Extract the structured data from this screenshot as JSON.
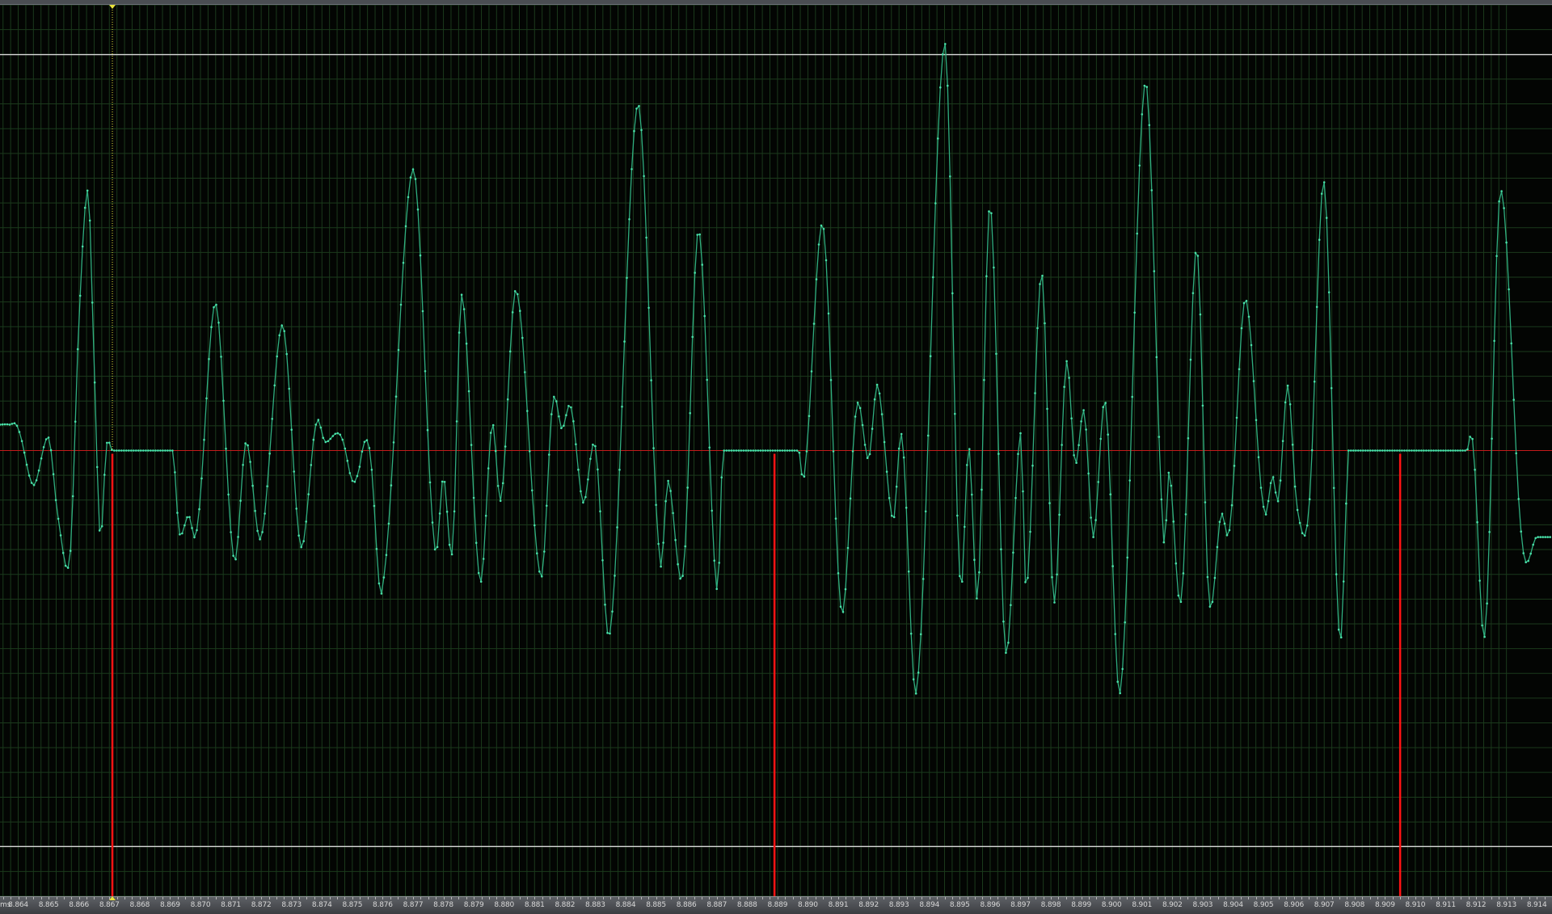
{
  "colors": {
    "background": "#030503",
    "grid": "#1b3a1c",
    "waveform": "#2fae7f",
    "sample_dot": "#49e0a8",
    "zero_line": "#c41a1a",
    "marker": "#ff1414",
    "limit_line": "#d8d8d8",
    "playhead": "#e8e23a",
    "ruler_text": "#d8d8d8"
  },
  "ruler": {
    "unit_label": "ms",
    "tick_labels": [
      "8.864",
      "8.865",
      "8.866",
      "8.867",
      "8.868",
      "8.869",
      "8.870",
      "8.871",
      "8.872",
      "8.873",
      "8.874",
      "8.875",
      "8.876",
      "8.877",
      "8.878",
      "8.879",
      "8.880",
      "8.881",
      "8.882",
      "8.883",
      "8.884",
      "8.885",
      "8.886",
      "8.887",
      "8.888",
      "8.889",
      "8.890",
      "8.891",
      "8.892",
      "8.893",
      "8.894",
      "8.895",
      "8.896",
      "8.897",
      "8.898",
      "8.899",
      "8.900",
      "8.901",
      "8.902",
      "8.903",
      "8.904",
      "8.905",
      "8.906",
      "8.907",
      "8.908",
      "8.909",
      "8.910",
      "8.911",
      "8.912",
      "8.913",
      "8.914"
    ]
  },
  "chart_data": {
    "type": "line",
    "x_unit": "ms",
    "x_range": [
      8.8634,
      8.9145
    ],
    "y_range": [
      -1.03,
      1.03
    ],
    "limit_levels": [
      0.915,
      -0.915
    ],
    "playhead_ms": 8.8671,
    "transient_markers_ms": [
      8.8671,
      8.8889,
      8.9095
    ],
    "silent_segments_ms": [
      [
        8.8671,
        8.8691
      ],
      [
        8.8889,
        8.8897
      ],
      [
        8.9095,
        8.9117
      ]
    ],
    "waveform": {
      "name": "",
      "keypoints": [
        [
          8.8634,
          0.06
        ],
        [
          8.8637,
          0.06
        ],
        [
          8.864,
          0.05
        ],
        [
          8.8645,
          -0.08
        ],
        [
          8.865,
          0.03
        ],
        [
          8.8653,
          -0.15
        ],
        [
          8.8657,
          -0.25
        ],
        [
          8.866,
          0.3
        ],
        [
          8.8663,
          0.6
        ],
        [
          8.8665,
          0.2
        ],
        [
          8.8667,
          -0.2
        ],
        [
          8.8669,
          0.01
        ],
        [
          8.8671,
          0.0
        ],
        [
          8.8691,
          0.0
        ],
        [
          8.8693,
          -0.19
        ],
        [
          8.8696,
          -0.15
        ],
        [
          8.8699,
          -0.17
        ],
        [
          8.8705,
          0.34
        ],
        [
          8.8711,
          -0.25
        ],
        [
          8.8715,
          0.02
        ],
        [
          8.872,
          -0.2
        ],
        [
          8.8727,
          0.29
        ],
        [
          8.8733,
          -0.22
        ],
        [
          8.8738,
          0.06
        ],
        [
          8.8741,
          0.02
        ],
        [
          8.8745,
          0.04
        ],
        [
          8.8747,
          0.02
        ],
        [
          8.875,
          -0.07
        ],
        [
          8.8752,
          -0.05
        ],
        [
          8.8754,
          0.02
        ],
        [
          8.8756,
          -0.02
        ],
        [
          8.876,
          -0.31
        ],
        [
          8.877,
          0.65
        ],
        [
          8.8777,
          -0.21
        ],
        [
          8.878,
          -0.06
        ],
        [
          8.8783,
          -0.23
        ],
        [
          8.8786,
          0.36
        ],
        [
          8.8792,
          -0.3
        ],
        [
          8.8796,
          0.06
        ],
        [
          8.8799,
          -0.11
        ],
        [
          8.8804,
          0.37
        ],
        [
          8.8812,
          -0.29
        ],
        [
          8.8816,
          0.11
        ],
        [
          8.8819,
          0.05
        ],
        [
          8.8822,
          0.1
        ],
        [
          8.8826,
          -0.12
        ],
        [
          8.883,
          0.01
        ],
        [
          8.8835,
          -0.41
        ],
        [
          8.8844,
          0.8
        ],
        [
          8.8851,
          -0.23
        ],
        [
          8.8854,
          -0.07
        ],
        [
          8.8859,
          -0.28
        ],
        [
          8.8864,
          0.51
        ],
        [
          8.887,
          -0.32
        ],
        [
          8.8872,
          0.0
        ],
        [
          8.8889,
          0.0
        ],
        [
          8.8897,
          0.0
        ],
        [
          8.8899,
          -0.04
        ],
        [
          8.8905,
          0.52
        ],
        [
          8.8911,
          -0.37
        ],
        [
          8.8916,
          0.1
        ],
        [
          8.892,
          -0.02
        ],
        [
          8.8923,
          0.15
        ],
        [
          8.8928,
          -0.16
        ],
        [
          8.8931,
          0.03
        ],
        [
          8.8936,
          -0.54
        ],
        [
          8.8945,
          0.94
        ],
        [
          8.895,
          -0.29
        ],
        [
          8.8953,
          0.01
        ],
        [
          8.8956,
          -0.33
        ],
        [
          8.896,
          0.57
        ],
        [
          8.8965,
          -0.46
        ],
        [
          8.897,
          0.04
        ],
        [
          8.8972,
          -0.32
        ],
        [
          8.8977,
          0.41
        ],
        [
          8.8981,
          -0.35
        ],
        [
          8.8985,
          0.2
        ],
        [
          8.8988,
          -0.03
        ],
        [
          8.8991,
          0.09
        ],
        [
          8.8994,
          -0.2
        ],
        [
          8.8998,
          0.11
        ],
        [
          8.9003,
          -0.55
        ],
        [
          8.9011,
          0.85
        ],
        [
          8.9017,
          -0.18
        ],
        [
          8.9019,
          -0.05
        ],
        [
          8.9023,
          -0.34
        ],
        [
          8.9028,
          0.47
        ],
        [
          8.9032,
          -0.34
        ],
        [
          8.9036,
          -0.15
        ],
        [
          8.9039,
          -0.17
        ],
        [
          8.9044,
          0.35
        ],
        [
          8.905,
          -0.13
        ],
        [
          8.9053,
          -0.06
        ],
        [
          8.9055,
          -0.11
        ],
        [
          8.9058,
          0.15
        ],
        [
          8.9061,
          -0.13
        ],
        [
          8.9065,
          -0.13
        ],
        [
          8.907,
          0.62
        ],
        [
          8.9075,
          -0.43
        ],
        [
          8.9078,
          0.0
        ],
        [
          8.9095,
          0.0
        ],
        [
          8.9117,
          0.0
        ],
        [
          8.9119,
          0.01
        ],
        [
          8.9123,
          -0.42
        ],
        [
          8.9128,
          0.6
        ],
        [
          8.9135,
          -0.2
        ],
        [
          8.914,
          -0.2
        ]
      ]
    }
  }
}
